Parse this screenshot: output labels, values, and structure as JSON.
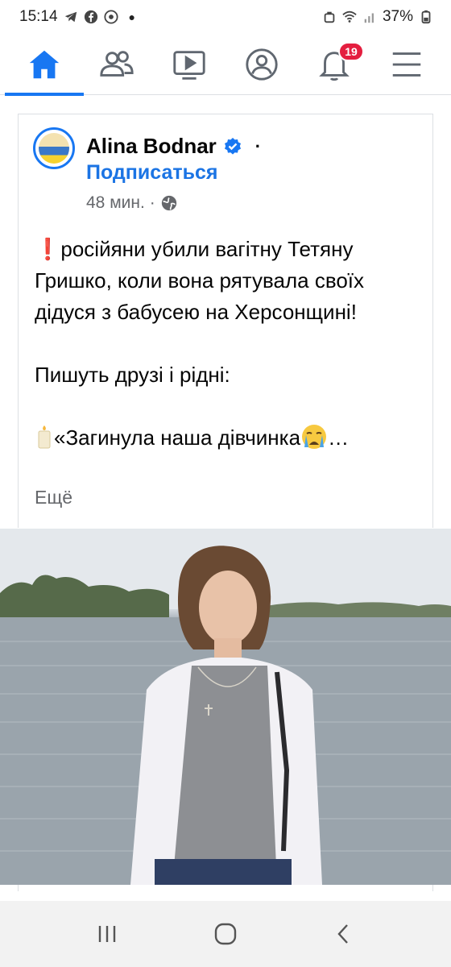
{
  "status_bar": {
    "time": "15:14",
    "battery": "37%"
  },
  "nav": {
    "items": [
      {
        "name": "home",
        "icon": "home-icon",
        "active": true
      },
      {
        "name": "friends",
        "icon": "friends-icon"
      },
      {
        "name": "watch",
        "icon": "video-icon"
      },
      {
        "name": "profile",
        "icon": "profile-icon"
      },
      {
        "name": "notifications",
        "icon": "bell-icon",
        "badge": "19"
      },
      {
        "name": "menu",
        "icon": "menu-icon"
      }
    ]
  },
  "post": {
    "author": "Alina Bodnar",
    "follow_label": "Подписаться",
    "time": "48 мин.",
    "text": {
      "line1": "російяни убили вагітну Тетяну Гришко, коли вона рятувала своїх дідуся з бабусею на Херсонщині!",
      "line2": "Пишуть друзі і рідні:",
      "line3": "«Загинула наша дівчинка"
    },
    "see_more": "Ещё"
  },
  "colors": {
    "accent": "#1877f2",
    "link": "#1b74e4",
    "badge": "#e41e3f",
    "meta": "#65676b"
  }
}
